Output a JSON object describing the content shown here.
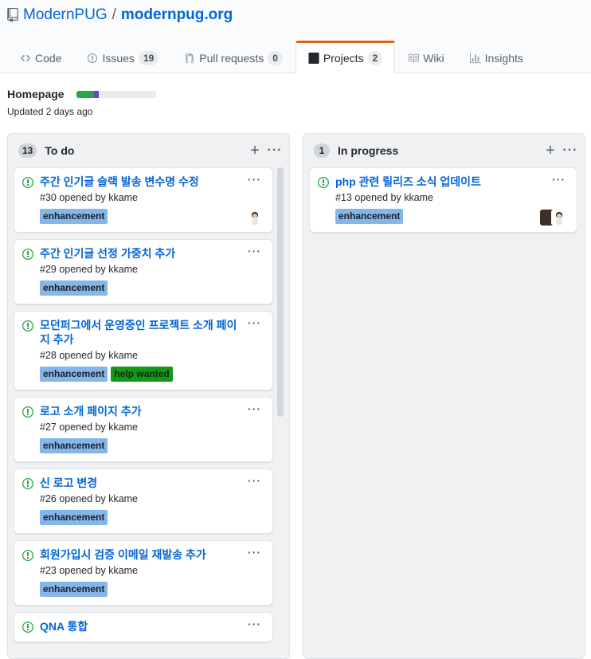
{
  "repo": {
    "owner": "ModernPUG",
    "separator": "/",
    "name": "modernpug.org"
  },
  "tabs": [
    {
      "label": "Code",
      "count": null,
      "icon": "code-icon"
    },
    {
      "label": "Issues",
      "count": "19",
      "icon": "issue-icon"
    },
    {
      "label": "Pull requests",
      "count": "0",
      "icon": "pull-request-icon"
    },
    {
      "label": "Projects",
      "count": "2",
      "icon": "project-icon",
      "selected": true
    },
    {
      "label": "Wiki",
      "count": null,
      "icon": "book-icon"
    },
    {
      "label": "Insights",
      "count": null,
      "icon": "graph-icon"
    }
  ],
  "project": {
    "name": "Homepage",
    "updated": "Updated 2 days ago",
    "progress": {
      "done_fraction": 0.22,
      "in_progress_fraction": 0.06
    }
  },
  "colors": {
    "link": "#0366d6",
    "open_issue": "#28a745",
    "enhancement": "#84b6eb",
    "help_wanted": "#159818",
    "tab_accent": "#e36209"
  },
  "columns": [
    {
      "title": "To do",
      "count": "13",
      "cards": [
        {
          "title": "주간 인기글 슬랙 발송 변수명 수정",
          "meta": "#30 opened by kkame",
          "labels": [
            "enhancement"
          ],
          "avatars": 1
        },
        {
          "title": "주간 인기글 선정 가중치 추가",
          "meta": "#29 opened by kkame",
          "labels": [
            "enhancement"
          ],
          "avatars": 0
        },
        {
          "title": "모던퍼그에서 운영중인 프로젝트 소개 페이지 추가",
          "meta": "#28 opened by kkame",
          "labels": [
            "enhancement",
            "help wanted"
          ],
          "avatars": 0
        },
        {
          "title": "로고 소개 페이지 추가",
          "meta": "#27 opened by kkame",
          "labels": [
            "enhancement"
          ],
          "avatars": 0
        },
        {
          "title": "신 로고 변경",
          "meta": "#26 opened by kkame",
          "labels": [
            "enhancement"
          ],
          "avatars": 0
        },
        {
          "title": "회원가입시 검증 이메일 재발송 추가",
          "meta": "#23 opened by kkame",
          "labels": [
            "enhancement"
          ],
          "avatars": 0
        },
        {
          "title": "QNA 통합",
          "meta": "",
          "labels": [],
          "avatars": 0
        }
      ]
    },
    {
      "title": "In progress",
      "count": "1",
      "cards": [
        {
          "title": "php 관련 릴리즈 소식 업데이트",
          "meta": "#13 opened by kkame",
          "labels": [
            "enhancement"
          ],
          "avatars": 2
        }
      ]
    }
  ]
}
